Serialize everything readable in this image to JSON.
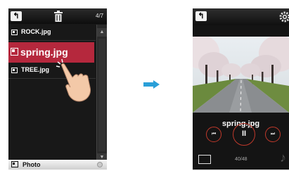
{
  "left_screen": {
    "counter": "4/7",
    "files": [
      {
        "name": "ROCK.jpg"
      },
      {
        "name": "spring.jpg"
      },
      {
        "name": "TREE.jpg"
      }
    ],
    "bottom_label": "Photo"
  },
  "right_screen": {
    "title": "spring.jpg",
    "counter": "40/48"
  },
  "colors": {
    "accent_red": "#b5283d",
    "arrow_blue": "#2a9fd8"
  }
}
